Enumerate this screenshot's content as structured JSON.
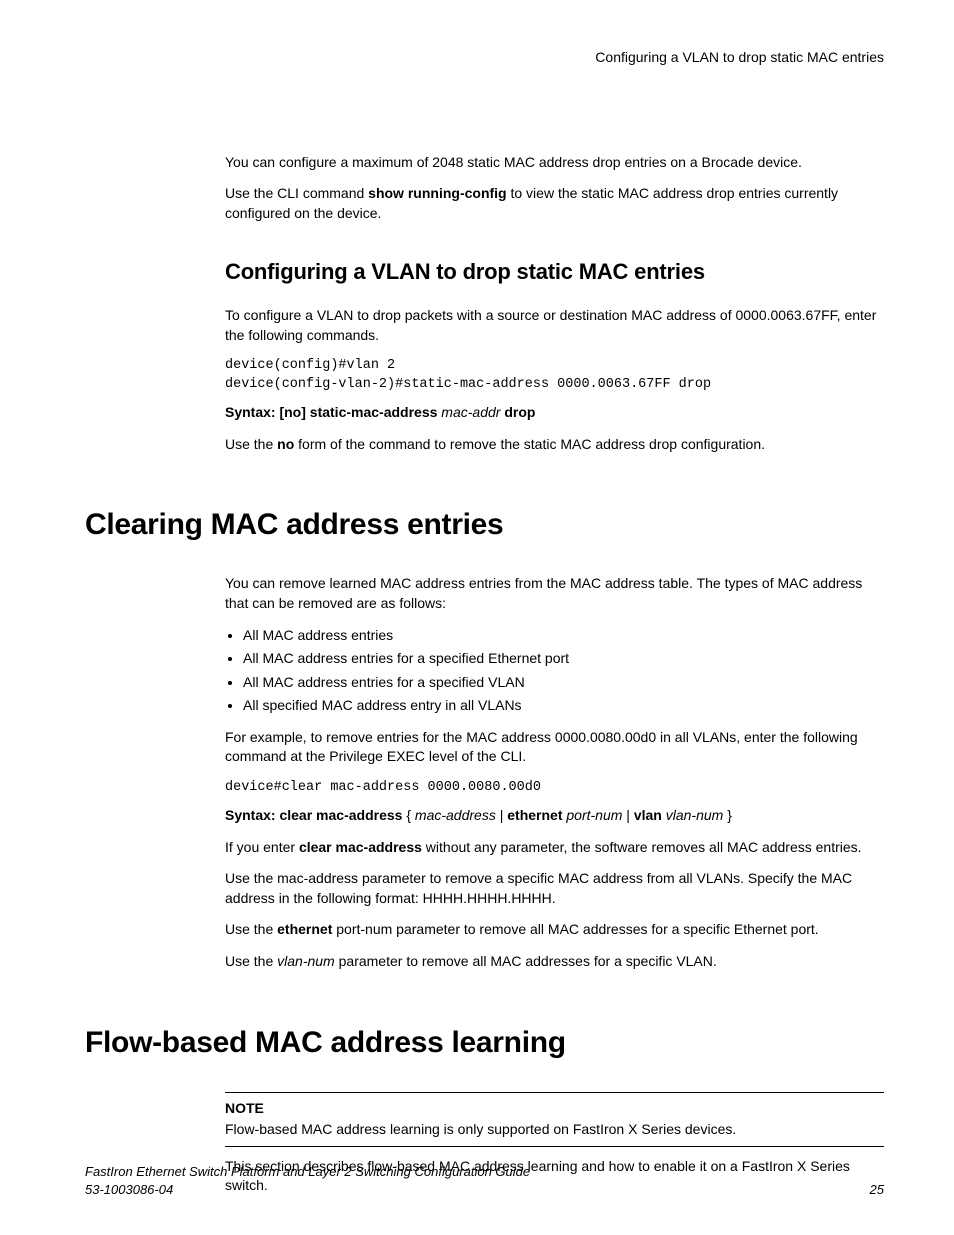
{
  "runningHead": "Configuring a VLAN to drop static MAC entries",
  "intro": {
    "p1": "You can configure a maximum of 2048 static MAC address drop entries on a Brocade device.",
    "p2a": "Use the CLI command ",
    "p2b": "show running-config",
    "p2c": " to view the static MAC address drop entries currently configured on the device."
  },
  "sec1": {
    "title": "Configuring a VLAN to drop static MAC entries",
    "p1": "To configure a VLAN to drop packets with a source or destination MAC address of 0000.0063.67FF, enter the following commands.",
    "code": "device(config)#vlan 2\ndevice(config-vlan-2)#static-mac-address 0000.0063.67FF drop",
    "syntaxA": "Syntax: [no] static-mac-address ",
    "syntaxB": "mac-addr",
    "syntaxC": " drop",
    "p2a": "Use the ",
    "p2b": "no",
    "p2c": " form of the command to remove the static MAC address drop configuration."
  },
  "sec2": {
    "title": "Clearing MAC address entries",
    "p1": "You can remove learned MAC address entries from the MAC address table. The types of MAC address that can be removed are as follows:",
    "bullets": [
      "All MAC address entries",
      "All MAC address entries for a specified Ethernet port",
      "All MAC address entries for a specified VLAN",
      "All specified MAC address entry in all VLANs"
    ],
    "p2": "For example, to remove entries for the MAC address 0000.0080.00d0 in all VLANs, enter the following command at the Privilege EXEC level of the CLI.",
    "code": "device#clear mac-address 0000.0080.00d0",
    "syntaxA": "Syntax: clear mac-address",
    "syntaxB": " { ",
    "syntaxC": "mac-address",
    "syntaxD": " | ",
    "syntaxE": "ethernet",
    "syntaxF": " ",
    "syntaxG": "port-num",
    "syntaxH": " | ",
    "syntaxI": "vlan",
    "syntaxJ": " ",
    "syntaxK": "vlan-num",
    "syntaxL": " }",
    "p3a": "If you enter ",
    "p3b": "clear mac-address",
    "p3c": " without any parameter, the software removes all MAC address entries.",
    "p4": "Use the mac-address parameter to remove a specific MAC address from all VLANs. Specify the MAC address in the following format: HHHH.HHHH.HHHH.",
    "p5a": "Use the ",
    "p5b": "ethernet",
    "p5c": " port-num parameter to remove all MAC addresses for a specific Ethernet port.",
    "p6a": "Use the ",
    "p6b": "vlan-num",
    "p6c": " parameter to remove all MAC addresses for a specific VLAN."
  },
  "sec3": {
    "title": "Flow-based MAC address learning",
    "noteLabel": "NOTE",
    "noteText": "Flow-based MAC address learning is only supported on FastIron X Series devices.",
    "p1": "This section describes flow-based MAC address learning and how to enable it on a FastIron X Series switch."
  },
  "footer": {
    "title": "FastIron Ethernet Switch Platform and Layer 2 Switching Configuration Guide",
    "docnum": "53-1003086-04",
    "page": "25"
  }
}
